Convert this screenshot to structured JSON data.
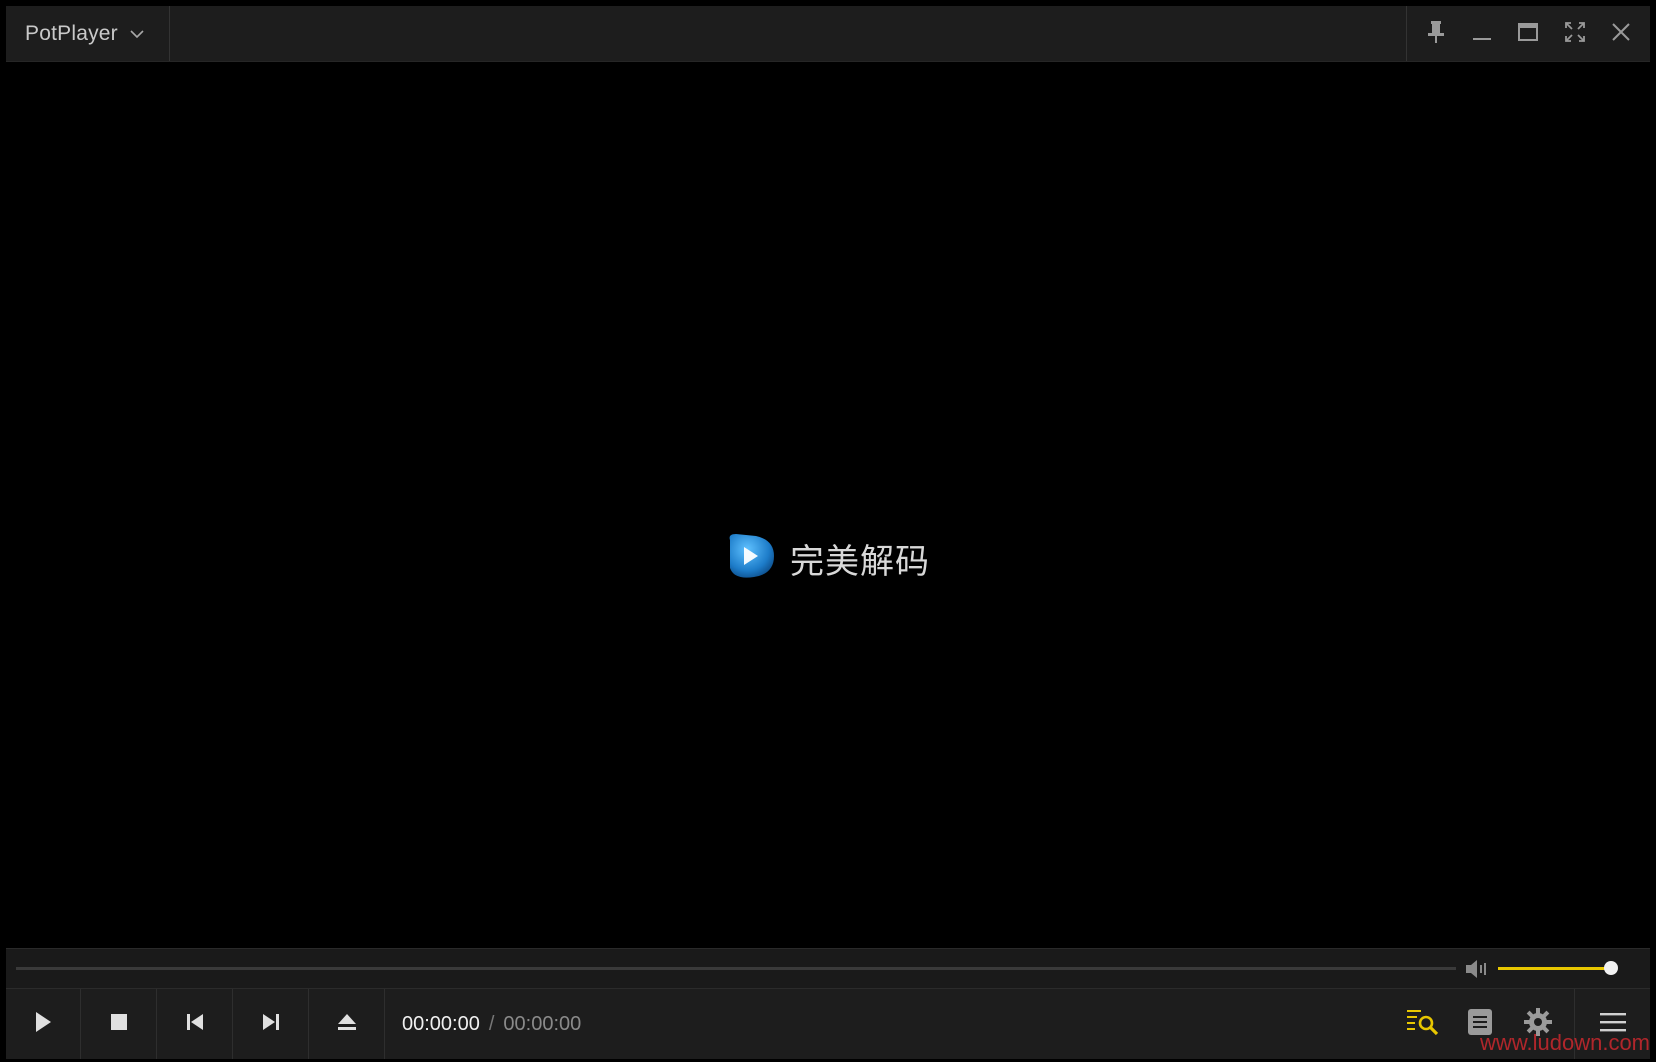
{
  "app": {
    "title": "PotPlayer"
  },
  "logo": {
    "text": "完美解码"
  },
  "playback": {
    "current_time": "00:00:00",
    "separator": "/",
    "total_time": "00:00:00",
    "progress": 0
  },
  "volume": {
    "level": 0.96
  },
  "colors": {
    "accent": "#e8c700",
    "background": "#000000",
    "bar": "#1d1d1d",
    "logo_blue": "#2b8fd6"
  },
  "icons": {
    "title_bar": [
      "chevron-down-icon",
      "pin-icon",
      "minimize-icon",
      "maximize-icon",
      "fullscreen-icon",
      "close-icon"
    ],
    "controls": [
      "play-icon",
      "stop-icon",
      "previous-icon",
      "next-icon",
      "eject-icon"
    ],
    "right_controls": [
      "playlist-search-icon",
      "chapter-list-icon",
      "gear-icon",
      "menu-icon"
    ],
    "volume": "speaker-icon"
  },
  "watermark": "www.ludown.com"
}
